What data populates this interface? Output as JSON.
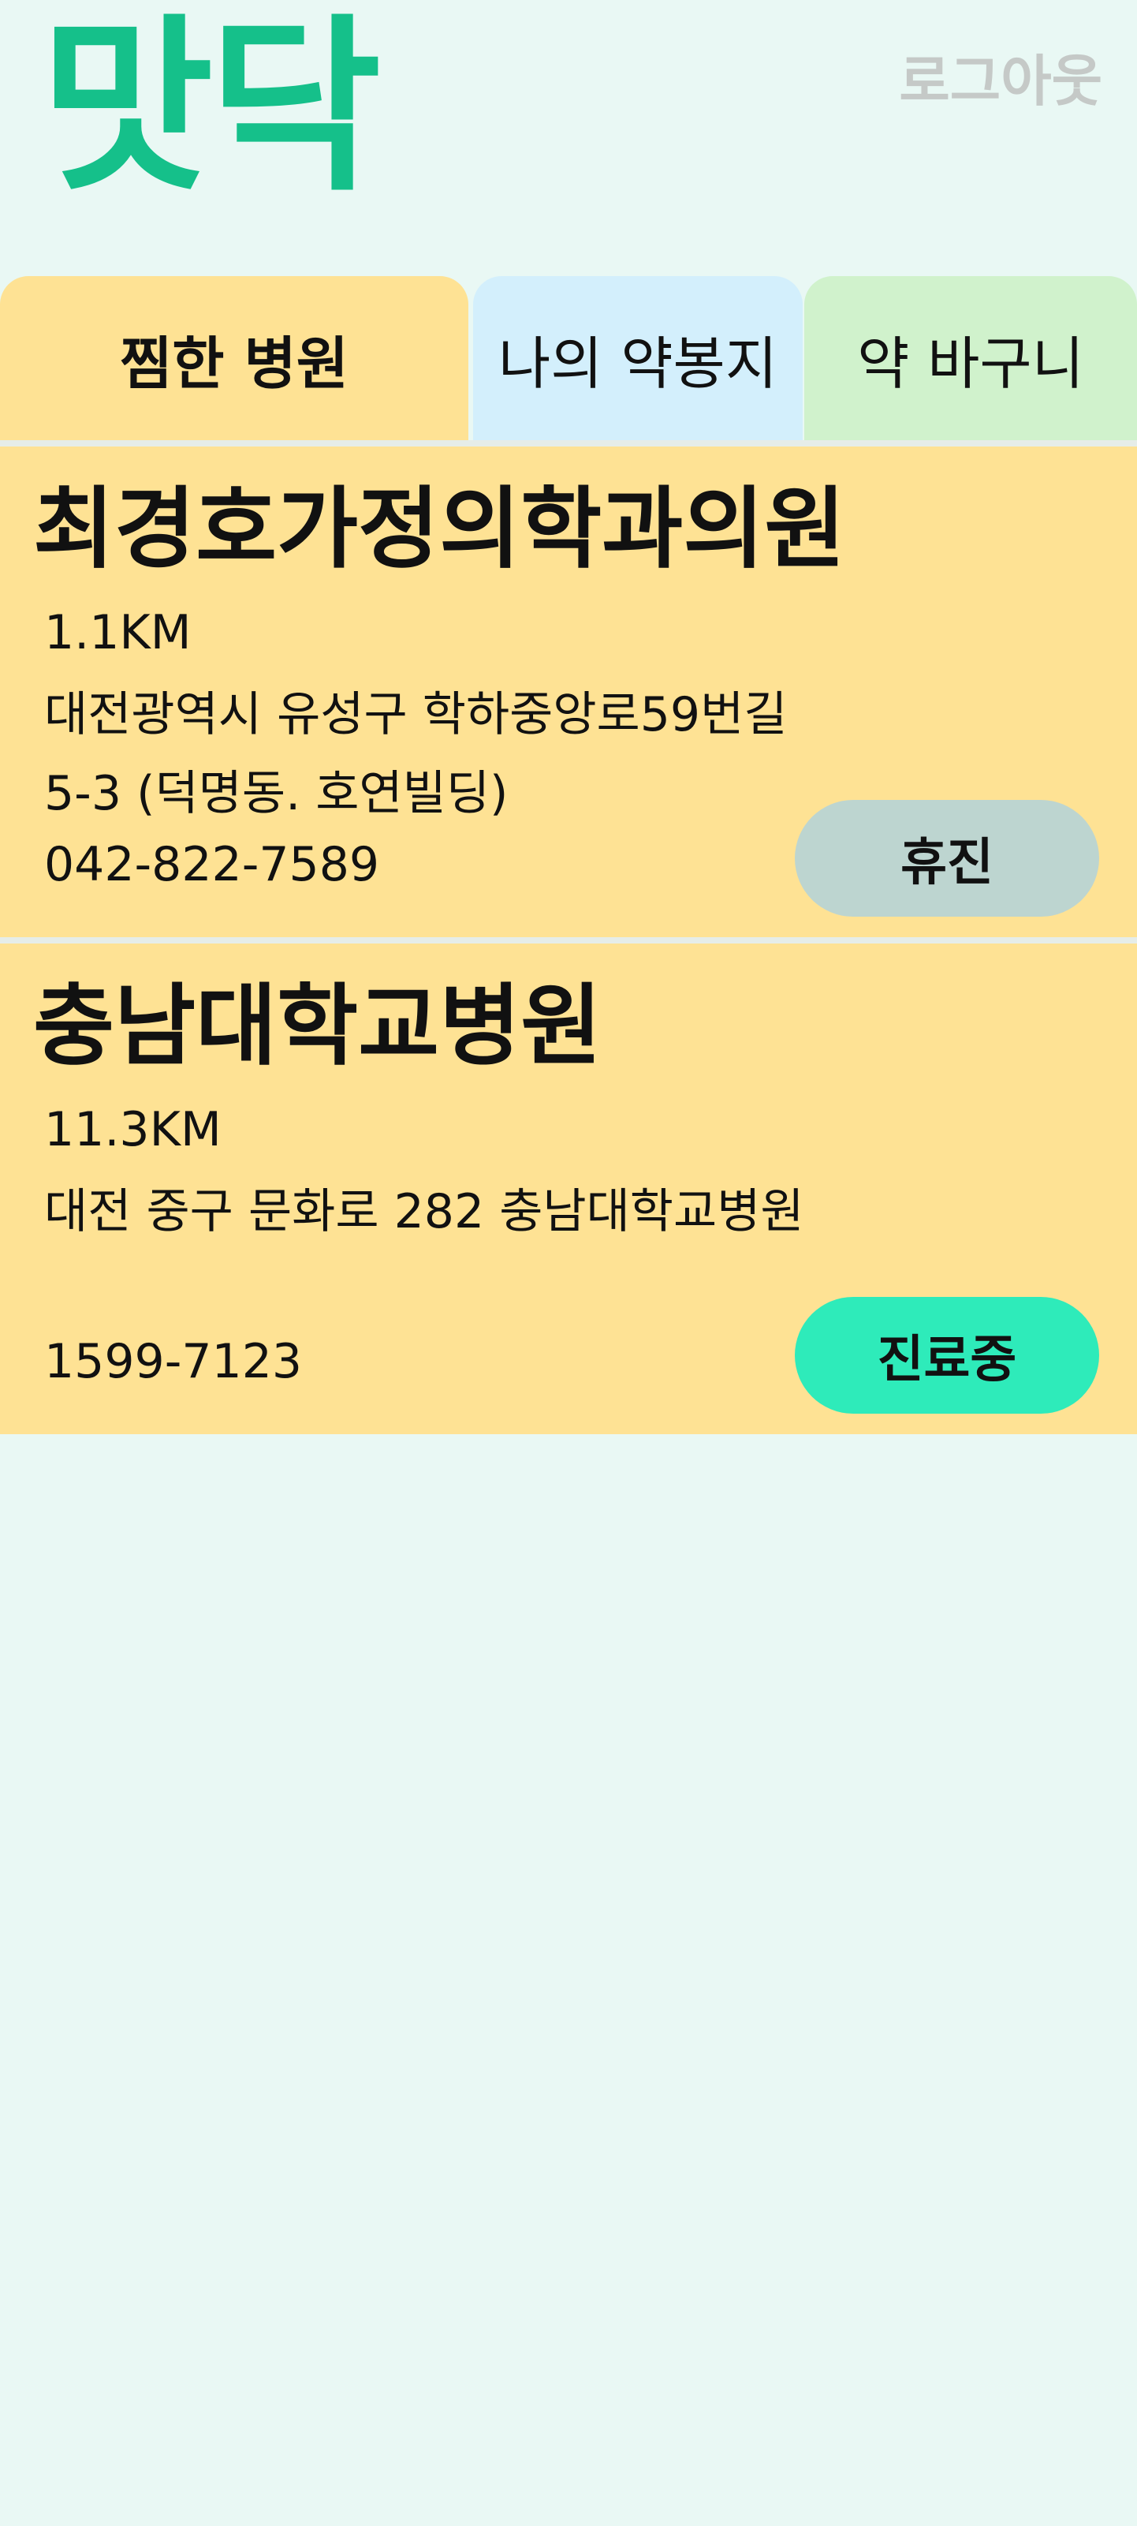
{
  "app": {
    "logo": "맛닥",
    "logout_label": "로그아웃"
  },
  "tabs": [
    {
      "label": "찜한 병원",
      "active": true
    },
    {
      "label": "나의 약봉지",
      "active": false
    },
    {
      "label": "약 바구니",
      "active": false
    }
  ],
  "hospitals": [
    {
      "name": "최경호가정의학과의원",
      "distance": "1.1KM",
      "address": "대전광역시 유성구 학하중앙로59번길 5-3 (덕명동. 호연빌딩)",
      "phone": "042-822-7589",
      "status": "휴진"
    },
    {
      "name": "충남대학교병원",
      "distance": "11.3KM",
      "address": "대전 중구 문화로 282 충남대학교병원",
      "phone": "1599-7123",
      "status": "진료중"
    }
  ],
  "colors": {
    "background": "#e9f8f4",
    "logo": "#15c08a",
    "card": "#fee294",
    "tab_pillbag": "#d3effc",
    "tab_basket": "#d0f2cc",
    "status_closed": "#bdd5d0",
    "status_open": "#2eebba"
  }
}
